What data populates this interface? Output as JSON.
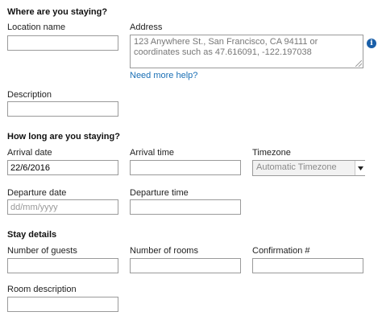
{
  "stay_location": {
    "title": "Where are you staying?",
    "location_name": {
      "label": "Location name",
      "value": ""
    },
    "address": {
      "label": "Address",
      "placeholder": "123 Anywhere St., San Francisco, CA 94111 or coordinates such as 47.616091, -122.197038",
      "help_link": "Need more help?",
      "info_icon": "info-icon"
    },
    "description": {
      "label": "Description",
      "value": ""
    }
  },
  "stay_duration": {
    "title": "How long are you staying?",
    "arrival_date": {
      "label": "Arrival date",
      "value": "22/6/2016"
    },
    "arrival_time": {
      "label": "Arrival time",
      "value": ""
    },
    "timezone": {
      "label": "Timezone",
      "selected": "Automatic Timezone"
    },
    "departure_date": {
      "label": "Departure date",
      "placeholder": "dd/mm/yyyy"
    },
    "departure_time": {
      "label": "Departure time",
      "value": ""
    }
  },
  "stay_details": {
    "title": "Stay details",
    "guests": {
      "label": "Number of guests",
      "value": ""
    },
    "rooms": {
      "label": "Number of rooms",
      "value": ""
    },
    "confirmation": {
      "label": "Confirmation #",
      "value": ""
    },
    "room_description": {
      "label": "Room description",
      "value": ""
    }
  },
  "colors": {
    "link": "#1a6fb5",
    "info_icon": "#1a5fa8",
    "input_border": "#9a9a9a"
  }
}
